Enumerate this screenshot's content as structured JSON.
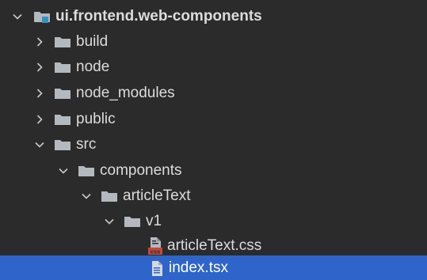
{
  "tree": {
    "root": {
      "label": "ui.frontend.web-components",
      "expanded": true
    },
    "items": [
      {
        "label": "build",
        "expanded": false,
        "type": "folder"
      },
      {
        "label": "node",
        "expanded": false,
        "type": "folder"
      },
      {
        "label": "node_modules",
        "expanded": false,
        "type": "folder"
      },
      {
        "label": "public",
        "expanded": false,
        "type": "folder"
      },
      {
        "label": "src",
        "expanded": true,
        "type": "folder"
      },
      {
        "label": "components",
        "expanded": true,
        "type": "folder"
      },
      {
        "label": "articleText",
        "expanded": true,
        "type": "folder"
      },
      {
        "label": "v1",
        "expanded": true,
        "type": "folder"
      },
      {
        "label": "articleText.css",
        "type": "file",
        "icon_badge": "css"
      },
      {
        "label": "index.tsx",
        "type": "file",
        "selected": true
      }
    ]
  },
  "colors": {
    "background": "#2b2b2b",
    "selection": "#2f65ca",
    "folder": "#b4b8bf",
    "module_accent": "#3592c4",
    "css_badge": "#c2493a"
  }
}
